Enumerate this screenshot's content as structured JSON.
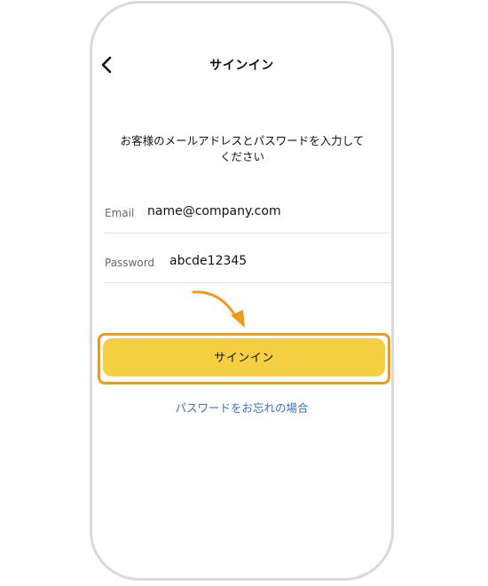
{
  "header": {
    "title": "サインイン"
  },
  "prompt": {
    "line1": "お客様のメールアドレスとパスワードを入力して",
    "line2": "ください"
  },
  "form": {
    "email": {
      "label": "Email",
      "value": "name@company.com"
    },
    "password": {
      "label": "Password",
      "value": "abcde12345"
    }
  },
  "actions": {
    "signin_label": "サインイン",
    "forgot_label": "パスワードをお忘れの場合"
  },
  "icons": {
    "back": "chevron-left-icon",
    "pointer": "arrow-icon"
  },
  "colors": {
    "button": "#f5cf42",
    "highlight": "#ef9a1b",
    "link": "#3b6fb6",
    "frame": "#d9d9d9"
  }
}
